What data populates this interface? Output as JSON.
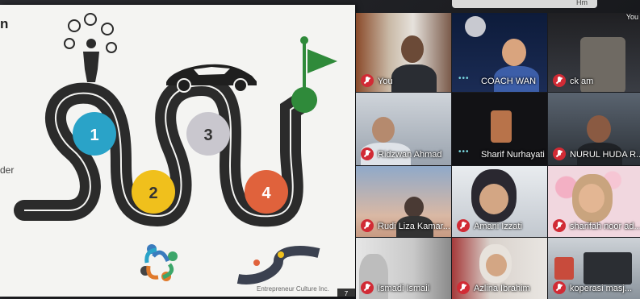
{
  "slide": {
    "title_fragment": "n",
    "side_text_fragment": "der",
    "footer_text": "Entrepreneur Culture Inc.",
    "page_number": "7",
    "milestones": [
      "1",
      "2",
      "3",
      "4"
    ],
    "colors": {
      "m1": "#2aa3c8",
      "m2": "#f0c01c",
      "m3": "#c9c7ce",
      "m4": "#e0623c",
      "flag": "#2f8a3a",
      "road": "#2b2b2b"
    }
  },
  "topbar": {
    "text": "Hm"
  },
  "participants": [
    {
      "name": "You",
      "mic": "muted",
      "self_badge": "You"
    },
    {
      "name": "COACH WAN",
      "mic": "speaking"
    },
    {
      "name": "ck am",
      "mic": "muted"
    },
    {
      "name": "Ridzwan Ahmad",
      "mic": "muted"
    },
    {
      "name": "Sharif Nurhayati",
      "mic": "speaking"
    },
    {
      "name": "NURUL HUDA R...",
      "mic": "muted"
    },
    {
      "name": "Rudi Liza Kamar...",
      "mic": "muted"
    },
    {
      "name": "Amani Izzati",
      "mic": "muted"
    },
    {
      "name": "sharifah noor ad...",
      "mic": "muted"
    },
    {
      "name": "Ismadi Ismail",
      "mic": "muted"
    },
    {
      "name": "Azlina Ibrahim",
      "mic": "muted"
    },
    {
      "name": "koperasi masj...",
      "mic": "muted"
    }
  ]
}
